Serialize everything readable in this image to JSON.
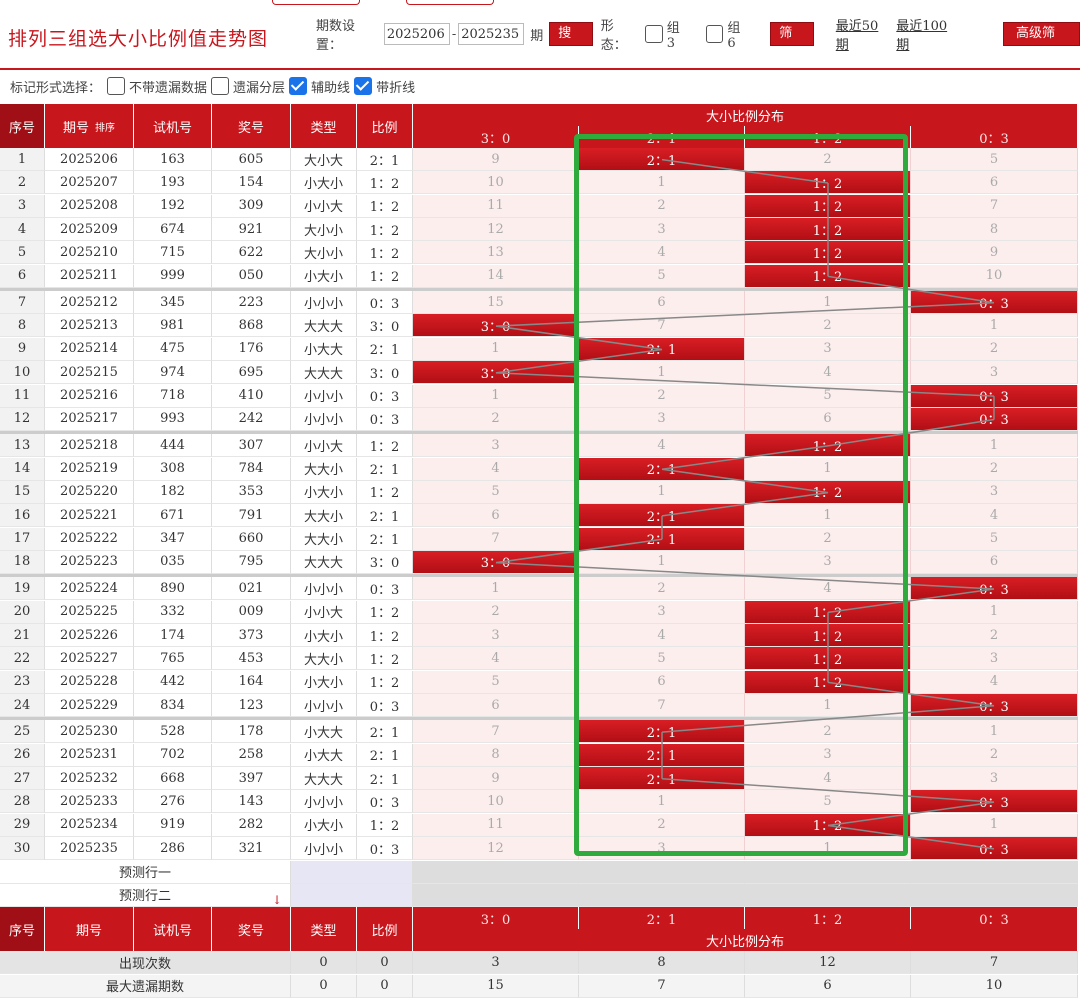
{
  "header": {
    "title": "排列三组选大小比例值走势图",
    "period_label": "期数设置：",
    "period_from": "2025206",
    "period_sep": "-",
    "period_to": "2025235",
    "period_unit": "期",
    "search_btn": "搜索",
    "form_label": "形态：",
    "group3": "组3",
    "group6": "组6",
    "filter_btn": "筛选",
    "recent50": "最近50期",
    "recent100": "最近100期",
    "advanced_btn": "高级筛选"
  },
  "markbar": {
    "label": "标记形式选择：",
    "options": [
      {
        "label": "不带遗漏数据",
        "checked": false
      },
      {
        "label": "遗漏分层",
        "checked": false
      },
      {
        "label": "辅助线",
        "checked": true
      },
      {
        "label": "带折线",
        "checked": true
      }
    ]
  },
  "table_header": {
    "seq": "序号",
    "period": "期号",
    "sort": "排序",
    "test_num": "试机号",
    "award": "奖号",
    "type": "类型",
    "ratio": "比例",
    "dist": "大小比例分布",
    "dist_cols": [
      "3：0",
      "2：1",
      "1：2",
      "0：3"
    ]
  },
  "rows": [
    {
      "seq": "1",
      "period": "2025206",
      "test": "163",
      "award": "605",
      "type": "大小大",
      "ratio": "2：1",
      "dist": [
        "9",
        "2：1",
        "2",
        "5"
      ],
      "hit": 1
    },
    {
      "seq": "2",
      "period": "2025207",
      "test": "193",
      "award": "154",
      "type": "小大小",
      "ratio": "1：2",
      "dist": [
        "10",
        "1",
        "1：2",
        "6"
      ],
      "hit": 2
    },
    {
      "seq": "3",
      "period": "2025208",
      "test": "192",
      "award": "309",
      "type": "小小大",
      "ratio": "1：2",
      "dist": [
        "11",
        "2",
        "1：2",
        "7"
      ],
      "hit": 2
    },
    {
      "seq": "4",
      "period": "2025209",
      "test": "674",
      "award": "921",
      "type": "大小小",
      "ratio": "1：2",
      "dist": [
        "12",
        "3",
        "1：2",
        "8"
      ],
      "hit": 2
    },
    {
      "seq": "5",
      "period": "2025210",
      "test": "715",
      "award": "622",
      "type": "大小小",
      "ratio": "1：2",
      "dist": [
        "13",
        "4",
        "1：2",
        "9"
      ],
      "hit": 2
    },
    {
      "seq": "6",
      "period": "2025211",
      "test": "999",
      "award": "050",
      "type": "小大小",
      "ratio": "1：2",
      "dist": [
        "14",
        "5",
        "1：2",
        "10"
      ],
      "hit": 2
    },
    {
      "seq": "7",
      "period": "2025212",
      "test": "345",
      "award": "223",
      "type": "小小小",
      "ratio": "0：3",
      "dist": [
        "15",
        "6",
        "1",
        "0：3"
      ],
      "hit": 3
    },
    {
      "seq": "8",
      "period": "2025213",
      "test": "981",
      "award": "868",
      "type": "大大大",
      "ratio": "3：0",
      "dist": [
        "3：0",
        "7",
        "2",
        "1"
      ],
      "hit": 0
    },
    {
      "seq": "9",
      "period": "2025214",
      "test": "475",
      "award": "176",
      "type": "小大大",
      "ratio": "2：1",
      "dist": [
        "1",
        "2：1",
        "3",
        "2"
      ],
      "hit": 1
    },
    {
      "seq": "10",
      "period": "2025215",
      "test": "974",
      "award": "695",
      "type": "大大大",
      "ratio": "3：0",
      "dist": [
        "3：0",
        "1",
        "4",
        "3"
      ],
      "hit": 0
    },
    {
      "seq": "11",
      "period": "2025216",
      "test": "718",
      "award": "410",
      "type": "小小小",
      "ratio": "0：3",
      "dist": [
        "1",
        "2",
        "5",
        "0：3"
      ],
      "hit": 3
    },
    {
      "seq": "12",
      "period": "2025217",
      "test": "993",
      "award": "242",
      "type": "小小小",
      "ratio": "0：3",
      "dist": [
        "2",
        "3",
        "6",
        "0：3"
      ],
      "hit": 3
    },
    {
      "seq": "13",
      "period": "2025218",
      "test": "444",
      "award": "307",
      "type": "小小大",
      "ratio": "1：2",
      "dist": [
        "3",
        "4",
        "1：2",
        "1"
      ],
      "hit": 2
    },
    {
      "seq": "14",
      "period": "2025219",
      "test": "308",
      "award": "784",
      "type": "大大小",
      "ratio": "2：1",
      "dist": [
        "4",
        "2：1",
        "1",
        "2"
      ],
      "hit": 1
    },
    {
      "seq": "15",
      "period": "2025220",
      "test": "182",
      "award": "353",
      "type": "小大小",
      "ratio": "1：2",
      "dist": [
        "5",
        "1",
        "1：2",
        "3"
      ],
      "hit": 2
    },
    {
      "seq": "16",
      "period": "2025221",
      "test": "671",
      "award": "791",
      "type": "大大小",
      "ratio": "2：1",
      "dist": [
        "6",
        "2：1",
        "1",
        "4"
      ],
      "hit": 1
    },
    {
      "seq": "17",
      "period": "2025222",
      "test": "347",
      "award": "660",
      "type": "大大小",
      "ratio": "2：1",
      "dist": [
        "7",
        "2：1",
        "2",
        "5"
      ],
      "hit": 1
    },
    {
      "seq": "18",
      "period": "2025223",
      "test": "035",
      "award": "795",
      "type": "大大大",
      "ratio": "3：0",
      "dist": [
        "3：0",
        "1",
        "3",
        "6"
      ],
      "hit": 0
    },
    {
      "seq": "19",
      "period": "2025224",
      "test": "890",
      "award": "021",
      "type": "小小小",
      "ratio": "0：3",
      "dist": [
        "1",
        "2",
        "4",
        "0：3"
      ],
      "hit": 3
    },
    {
      "seq": "20",
      "period": "2025225",
      "test": "332",
      "award": "009",
      "type": "小小大",
      "ratio": "1：2",
      "dist": [
        "2",
        "3",
        "1：2",
        "1"
      ],
      "hit": 2
    },
    {
      "seq": "21",
      "period": "2025226",
      "test": "174",
      "award": "373",
      "type": "小大小",
      "ratio": "1：2",
      "dist": [
        "3",
        "4",
        "1：2",
        "2"
      ],
      "hit": 2
    },
    {
      "seq": "22",
      "period": "2025227",
      "test": "765",
      "award": "453",
      "type": "大大小",
      "ratio": "1：2",
      "dist": [
        "4",
        "5",
        "1：2",
        "3"
      ],
      "hit": 2
    },
    {
      "seq": "23",
      "period": "2025228",
      "test": "442",
      "award": "164",
      "type": "小大小",
      "ratio": "1：2",
      "dist": [
        "5",
        "6",
        "1：2",
        "4"
      ],
      "hit": 2
    },
    {
      "seq": "24",
      "period": "2025229",
      "test": "834",
      "award": "123",
      "type": "小小小",
      "ratio": "0：3",
      "dist": [
        "6",
        "7",
        "1",
        "0：3"
      ],
      "hit": 3
    },
    {
      "seq": "25",
      "period": "2025230",
      "test": "528",
      "award": "178",
      "type": "小大大",
      "ratio": "2：1",
      "dist": [
        "7",
        "2：1",
        "2",
        "1"
      ],
      "hit": 1
    },
    {
      "seq": "26",
      "period": "2025231",
      "test": "702",
      "award": "258",
      "type": "小大大",
      "ratio": "2：1",
      "dist": [
        "8",
        "2：1",
        "3",
        "2"
      ],
      "hit": 1
    },
    {
      "seq": "27",
      "period": "2025232",
      "test": "668",
      "award": "397",
      "type": "大大大",
      "ratio": "2：1",
      "dist": [
        "9",
        "2：1",
        "4",
        "3"
      ],
      "hit": 1
    },
    {
      "seq": "28",
      "period": "2025233",
      "test": "276",
      "award": "143",
      "type": "小小小",
      "ratio": "0：3",
      "dist": [
        "10",
        "1",
        "5",
        "0：3"
      ],
      "hit": 3
    },
    {
      "seq": "29",
      "period": "2025234",
      "test": "919",
      "award": "282",
      "type": "小大小",
      "ratio": "1：2",
      "dist": [
        "11",
        "2",
        "1：2",
        "1"
      ],
      "hit": 2
    },
    {
      "seq": "30",
      "period": "2025235",
      "test": "286",
      "award": "321",
      "type": "小小小",
      "ratio": "0：3",
      "dist": [
        "12",
        "3",
        "1",
        "0：3"
      ],
      "hit": 3
    }
  ],
  "predict": {
    "row1": "预测行一",
    "row2": "预测行二"
  },
  "footer": {
    "appear_label": "出现次数",
    "appear_type": "0",
    "appear_ratio": "0",
    "appear_vals": [
      "3",
      "8",
      "12",
      "7"
    ],
    "maxmiss_label": "最大遗漏期数",
    "maxmiss_type": "0",
    "maxmiss_ratio": "0",
    "maxmiss_vals": [
      "15",
      "7",
      "6",
      "10"
    ]
  },
  "colors": {
    "accent": "#c8161d",
    "highlight_box": "#2faa3c"
  }
}
